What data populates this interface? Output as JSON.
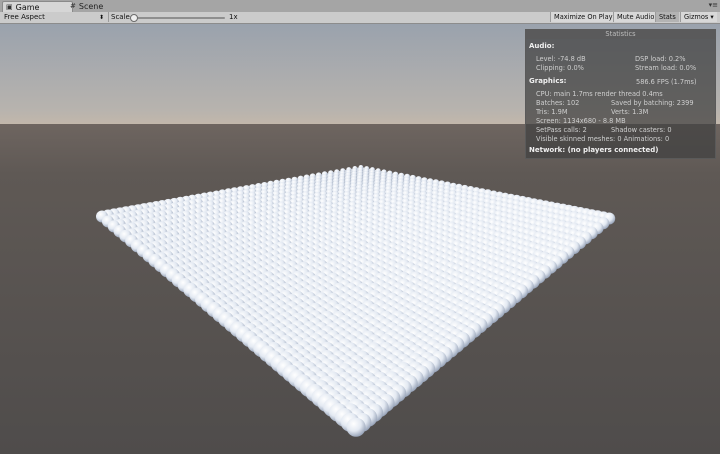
{
  "tabs": [
    {
      "label": "Game",
      "icon": "game-icon"
    },
    {
      "label": "Scene",
      "icon": "scene-icon"
    }
  ],
  "window_controls": "▾≡",
  "toolbar": {
    "aspect": "Free Aspect",
    "scale_label": "Scale",
    "scale_value": "1x",
    "scale_fraction": 0.0,
    "buttons": [
      "Maximize On Play",
      "Mute Audio",
      "Stats",
      "Gizmos"
    ],
    "gizmos_arrow": "▾"
  },
  "stats": {
    "title": "Statistics",
    "audio_header": "Audio:",
    "audio_level": "Level: -74.8 dB",
    "audio_dsp": "DSP load: 0.2%",
    "audio_clipping": "Clipping: 0.0%",
    "audio_stream": "Stream load: 0.0%",
    "graphics_header": "Graphics:",
    "fps": "586.6 FPS (1.7ms)",
    "cpu": "CPU: main 1.7ms  render thread 0.4ms",
    "batches": "Batches: 102",
    "saved_batching": "Saved by batching: 2399",
    "tris": "Tris: 1.9M",
    "verts": "Verts: 1.3M",
    "screen": "Screen: 1134x680 - 8.8 MB",
    "setpass": "SetPass calls: 2",
    "shadow_casters": "Shadow casters: 0",
    "skinned": "Visible skinned meshes: 0  Animations: 0",
    "network": "Network: (no players connected)"
  },
  "colors": {
    "sky_top": "#9aa2ad",
    "horizon": "#bcb5ad",
    "ground": "#5a5552",
    "sphere": "#e9eef6",
    "sphere_shade": "#9aa6bb"
  }
}
